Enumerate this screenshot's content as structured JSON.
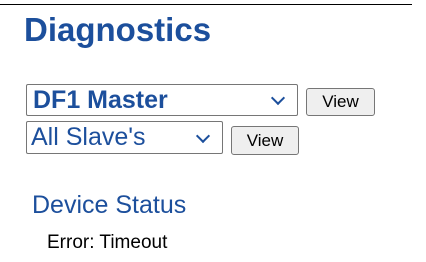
{
  "page": {
    "title": "Diagnostics"
  },
  "controls": {
    "protocol_select": {
      "selected": "DF1 Master"
    },
    "protocol_view_label": "View",
    "slave_select": {
      "selected": "All Slave's"
    },
    "slave_view_label": "View"
  },
  "device_status": {
    "heading": "Device Status",
    "text": "Error: Timeout"
  },
  "icons": {
    "dropdown": "chevron-down-icon"
  },
  "colors": {
    "accent": "#1c4f9c",
    "button_bg": "#efefef",
    "border": "#767676"
  }
}
